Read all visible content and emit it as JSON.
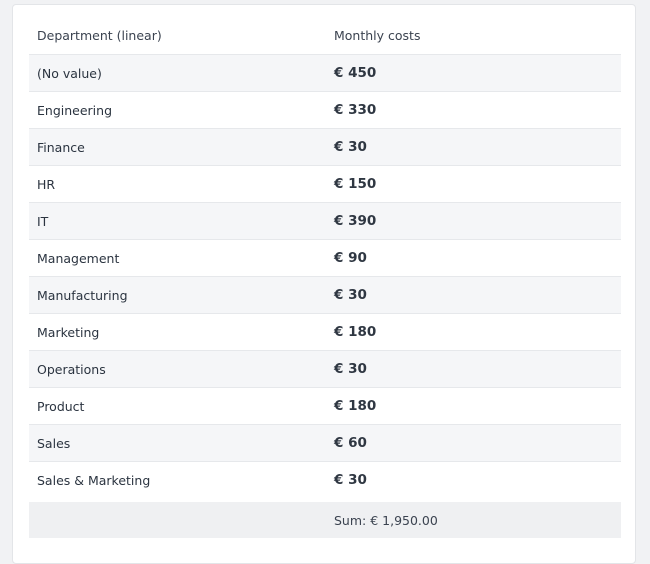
{
  "table": {
    "headers": [
      "Department (linear)",
      "Monthly costs"
    ],
    "rows": [
      {
        "department": "(No value)",
        "cost": "€ 450"
      },
      {
        "department": "Engineering",
        "cost": "€ 330"
      },
      {
        "department": "Finance",
        "cost": "€ 30"
      },
      {
        "department": "HR",
        "cost": "€ 150"
      },
      {
        "department": "IT",
        "cost": "€ 390"
      },
      {
        "department": "Management",
        "cost": "€ 90"
      },
      {
        "department": "Manufacturing",
        "cost": "€ 30"
      },
      {
        "department": "Marketing",
        "cost": "€ 180"
      },
      {
        "department": "Operations",
        "cost": "€ 30"
      },
      {
        "department": "Product",
        "cost": "€ 180"
      },
      {
        "department": "Sales",
        "cost": "€ 60"
      },
      {
        "department": "Sales & Marketing",
        "cost": "€ 30"
      }
    ],
    "footer": {
      "label": "",
      "sum": "Sum: € 1,950.00"
    }
  }
}
